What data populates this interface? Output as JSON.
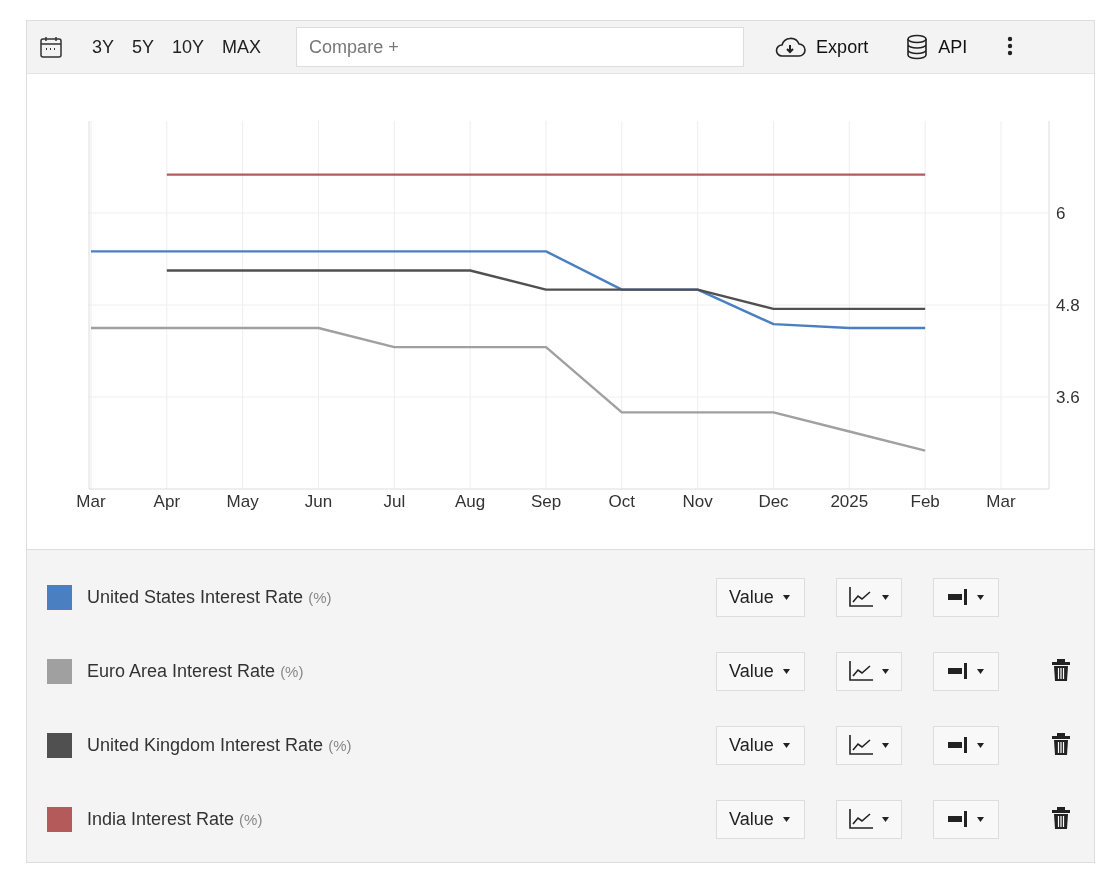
{
  "toolbar": {
    "ranges": [
      {
        "label": "3Y",
        "selected": false
      },
      {
        "label": "5Y",
        "selected": false
      },
      {
        "label": "10Y",
        "selected": false
      },
      {
        "label": "MAX",
        "selected": false
      }
    ],
    "compare": {
      "placeholder": "Compare +"
    },
    "export": "Export",
    "api": "API"
  },
  "chart": {
    "chart_data": {
      "type": "line",
      "grid": true,
      "categories": [
        "Mar",
        "Apr",
        "May",
        "Jun",
        "Jul",
        "Aug",
        "Sep",
        "Oct",
        "Nov",
        "Dec",
        "2025",
        "Feb",
        "Mar"
      ],
      "ylim": [
        2.4,
        7.2
      ],
      "yticks": [
        3.6,
        4.8,
        6
      ],
      "series": [
        {
          "name": "United States Interest Rate",
          "color": "#4a7fc1",
          "values": [
            5.5,
            5.5,
            5.5,
            5.5,
            5.5,
            5.5,
            5.5,
            5.0,
            5.0,
            4.55,
            4.5,
            4.5,
            null
          ]
        },
        {
          "name": "Euro Area Interest Rate",
          "color": "#a0a0a0",
          "values": [
            4.5,
            4.5,
            4.5,
            4.5,
            4.25,
            4.25,
            4.25,
            3.4,
            3.4,
            3.4,
            3.15,
            2.9,
            null
          ]
        },
        {
          "name": "United Kingdom Interest Rate",
          "color": "#505050",
          "values": [
            null,
            5.25,
            5.25,
            5.25,
            5.25,
            5.25,
            5.0,
            5.0,
            5.0,
            4.75,
            4.75,
            4.75,
            null
          ]
        },
        {
          "name": "India Interest Rate",
          "color": "#b55a5a",
          "values": [
            null,
            6.5,
            6.5,
            6.5,
            6.5,
            6.5,
            6.5,
            6.5,
            6.5,
            6.5,
            6.5,
            6.5,
            null
          ]
        }
      ]
    }
  },
  "legend": [
    {
      "unit": "(%)",
      "mode": "Value",
      "deletable": false
    },
    {
      "unit": "(%)",
      "mode": "Value",
      "deletable": true
    },
    {
      "unit": "(%)",
      "mode": "Value",
      "deletable": true
    },
    {
      "unit": "(%)",
      "mode": "Value",
      "deletable": true
    }
  ]
}
